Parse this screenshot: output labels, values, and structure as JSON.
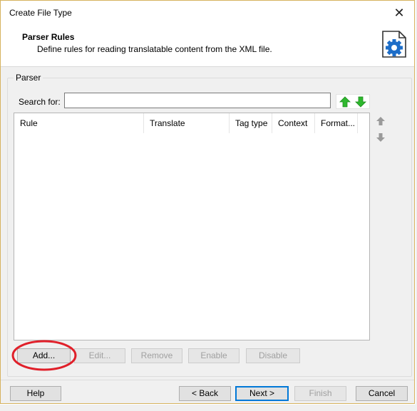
{
  "window": {
    "title": "Create File Type"
  },
  "header": {
    "title": "Parser Rules",
    "subtitle": "Define rules for reading translatable content from the XML file."
  },
  "group": {
    "label": "Parser"
  },
  "search": {
    "label": "Search for:",
    "value": ""
  },
  "list": {
    "columns": [
      "Rule",
      "Translate",
      "Tag type",
      "Context",
      "Format..."
    ],
    "rows": []
  },
  "rule_buttons": {
    "add": "Add...",
    "edit": "Edit...",
    "remove": "Remove",
    "enable": "Enable",
    "disable": "Disable"
  },
  "footer": {
    "help": "Help",
    "back": "< Back",
    "next": "Next >",
    "finish": "Finish",
    "cancel": "Cancel"
  },
  "colors": {
    "accent": "#0078d7",
    "annotation": "#e0202a",
    "arrow_green": "#2eb82e",
    "icon_blue": "#1e6ec8"
  },
  "icons": {
    "close": "close-icon",
    "settings_doc": "settings-document-icon",
    "move_up_green": "arrow-up-icon",
    "move_down_green": "arrow-down-icon",
    "move_up_gray": "arrow-up-icon",
    "move_down_gray": "arrow-down-icon"
  }
}
